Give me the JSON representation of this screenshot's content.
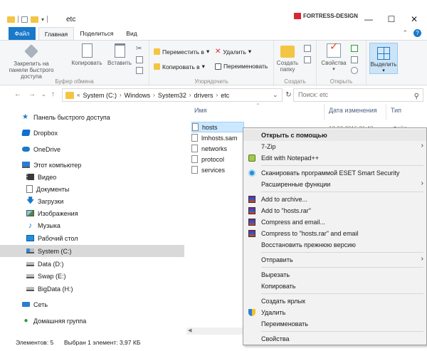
{
  "window": {
    "title": "etc",
    "brand": "FORTRESS-DESIGN",
    "controls": {
      "minimize": "—",
      "maximize": "☐",
      "close": "✕"
    }
  },
  "ribbon_tabs": {
    "file": "Файл",
    "home": "Главная",
    "share": "Поделиться",
    "view": "Вид"
  },
  "ribbon": {
    "clipboard": {
      "pin": "Закрепить на панели быстрого доступа",
      "copy": "Копировать",
      "paste": "Вставить",
      "label": "Буфер обмена"
    },
    "organize": {
      "move": "Переместить в",
      "delete": "Удалить",
      "copy_to": "Копировать в",
      "rename": "Переименовать",
      "label": "Упорядочить"
    },
    "new": {
      "new_folder": "Создать папку",
      "label": "Создать"
    },
    "open": {
      "properties": "Свойства",
      "label": "Открыть"
    },
    "select": {
      "select": "Выделить"
    }
  },
  "address": {
    "crumbs": [
      "System (C:)",
      "Windows",
      "System32",
      "drivers",
      "etc"
    ],
    "search_placeholder": "Поиск: etc"
  },
  "navpane": {
    "items": [
      {
        "label": "Панель быстрого доступа",
        "icon": "star-icon"
      },
      {
        "label": "Dropbox",
        "icon": "dropbox-icon"
      },
      {
        "label": "OneDrive",
        "icon": "cloud-icon"
      },
      {
        "label": "Этот компьютер",
        "icon": "computer-icon"
      },
      {
        "label": "Видео",
        "icon": "video-folder-icon"
      },
      {
        "label": "Документы",
        "icon": "documents-folder-icon"
      },
      {
        "label": "Загрузки",
        "icon": "downloads-folder-icon"
      },
      {
        "label": "Изображения",
        "icon": "pictures-folder-icon"
      },
      {
        "label": "Музыка",
        "icon": "music-folder-icon"
      },
      {
        "label": "Рабочий стол",
        "icon": "desktop-folder-icon"
      },
      {
        "label": "System (C:)",
        "icon": "system-drive-icon"
      },
      {
        "label": "Data (D:)",
        "icon": "drive-icon"
      },
      {
        "label": "Swap (E:)",
        "icon": "drive-icon"
      },
      {
        "label": "BigData (H:)",
        "icon": "drive-icon"
      },
      {
        "label": "Сеть",
        "icon": "network-icon"
      },
      {
        "label": "Домашняя группа",
        "icon": "homegroup-icon"
      }
    ]
  },
  "filelist": {
    "columns": {
      "name": "Имя",
      "date": "Дата изменения",
      "type": "Тип"
    },
    "files": [
      "hosts",
      "lmhosts.sam",
      "networks",
      "protocol",
      "services"
    ],
    "hosts_date": "12.03.2016 21:42",
    "hosts_type": "Файл"
  },
  "context_menu": {
    "items": [
      "Открыть с помощью",
      "7-Zip",
      "Edit with Notepad++",
      "Сканировать программой ESET Smart Security",
      "Расширенные функции",
      "Add to archive...",
      "Add to \"hosts.rar\"",
      "Compress and email...",
      "Compress to \"hosts.rar\" and email",
      "Восстановить прежнюю версию",
      "Отправить",
      "Вырезать",
      "Копировать",
      "Создать ярлык",
      "Удалить",
      "Переименовать",
      "Свойства"
    ]
  },
  "statusbar": {
    "count": "Элементов: 5",
    "selected": "Выбран 1 элемент: 3,97 КБ"
  }
}
